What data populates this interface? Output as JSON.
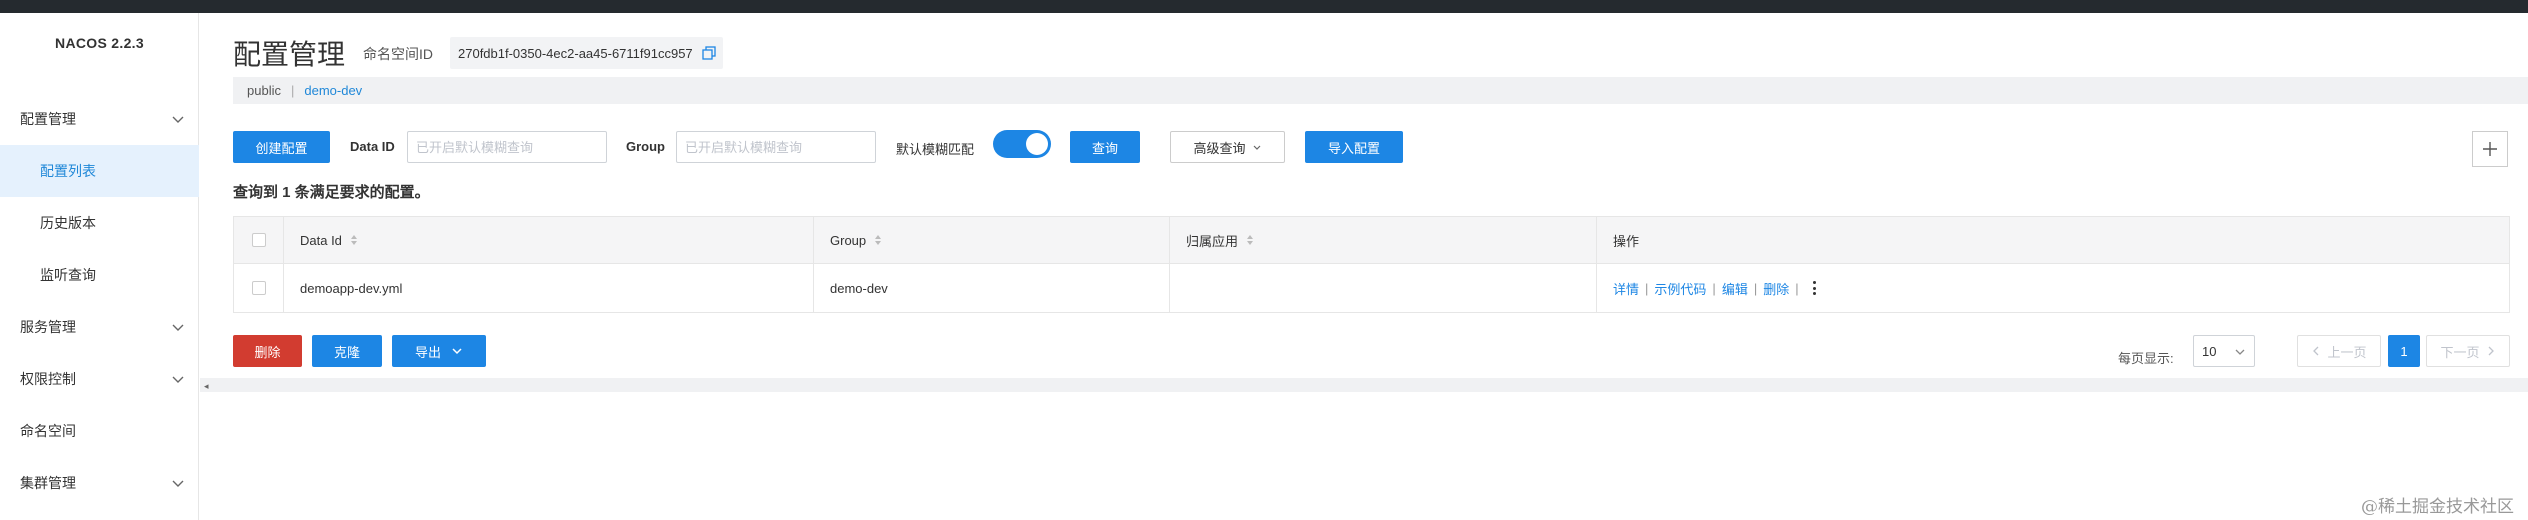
{
  "brand": "NACOS 2.2.3",
  "sidebar": {
    "items": [
      {
        "label": "配置管理",
        "expandable": true
      },
      {
        "label": "配置列表",
        "active": true
      },
      {
        "label": "历史版本"
      },
      {
        "label": "监听查询"
      },
      {
        "label": "服务管理",
        "expandable": true
      },
      {
        "label": "权限控制",
        "expandable": true
      },
      {
        "label": "命名空间"
      },
      {
        "label": "集群管理",
        "expandable": true
      }
    ]
  },
  "header": {
    "title": "配置管理",
    "namespace_label": "命名空间ID",
    "namespace_id": "270fdb1f-0350-4ec2-aa45-6711f91cc957"
  },
  "breadcrumb": {
    "items": [
      "public",
      "demo-dev"
    ],
    "separator": "|"
  },
  "toolbar": {
    "create_label": "创建配置",
    "data_id_label": "Data ID",
    "data_id_placeholder": "已开启默认模糊查询",
    "group_label": "Group",
    "group_placeholder": "已开启默认模糊查询",
    "fuzzy_label": "默认模糊匹配",
    "fuzzy_on": true,
    "search_label": "查询",
    "advanced_label": "高级查询",
    "import_label": "导入配置",
    "plus_label": "+"
  },
  "result_text": "查询到 1 条满足要求的配置。",
  "table": {
    "headers": [
      "Data Id",
      "Group",
      "归属应用",
      "操作"
    ],
    "rows": [
      {
        "data_id": "demoapp-dev.yml",
        "group": "demo-dev",
        "app": "",
        "ops": [
          "详情",
          "示例代码",
          "编辑",
          "删除"
        ]
      }
    ]
  },
  "actions": {
    "delete_label": "删除",
    "clone_label": "克隆",
    "export_label": "导出"
  },
  "pagination": {
    "page_size_label": "每页显示:",
    "page_size": "10",
    "prev_label": "上一页",
    "next_label": "下一页",
    "current_page": "1"
  },
  "watermark": "@稀土掘金技术社区",
  "colors": {
    "primary": "#1d86e4",
    "danger": "#d23c30",
    "active_bg": "#e5f1fd",
    "topbar": "#252a2f"
  }
}
